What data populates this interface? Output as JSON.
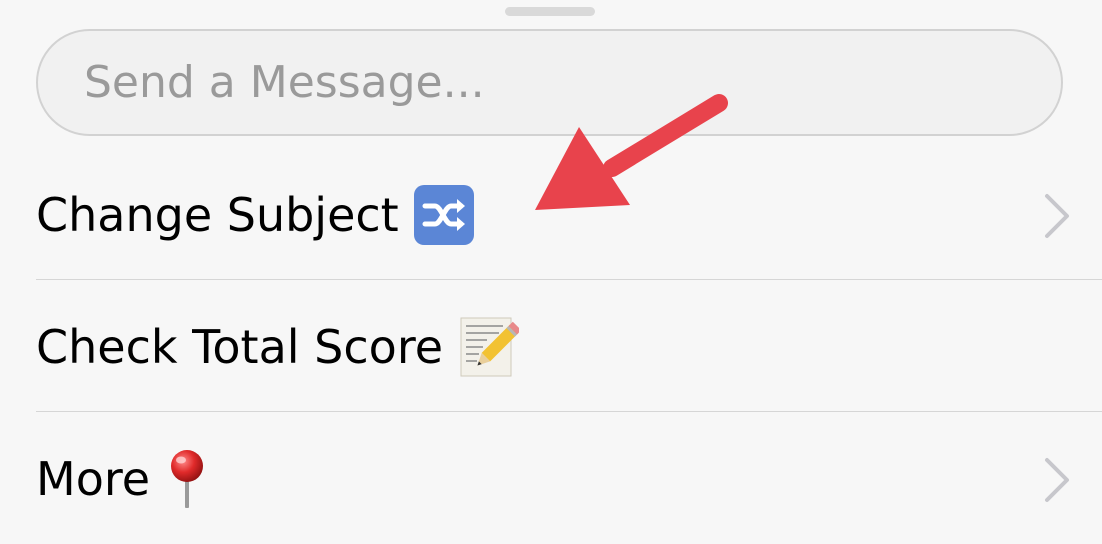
{
  "message_input": {
    "placeholder": "Send a Message...",
    "value": ""
  },
  "menu": {
    "items": [
      {
        "label": "Change Subject",
        "icon": "shuffle-icon",
        "has_chevron": true
      },
      {
        "label": "Check Total Score",
        "icon": "memo-pencil-icon",
        "has_chevron": false
      },
      {
        "label": "More",
        "icon": "pushpin-icon",
        "has_chevron": true
      }
    ]
  },
  "annotation": {
    "type": "arrow",
    "color": "#e8434c",
    "points_to": "Change Subject"
  },
  "colors": {
    "background": "#f7f7f7",
    "input_background": "#f1f1f1",
    "input_border": "#d2d2d2",
    "placeholder": "#9a9a9a",
    "divider": "#d6d6d6",
    "chevron": "#c7c7cc",
    "shuffle_icon_bg": "#5b86d6"
  }
}
